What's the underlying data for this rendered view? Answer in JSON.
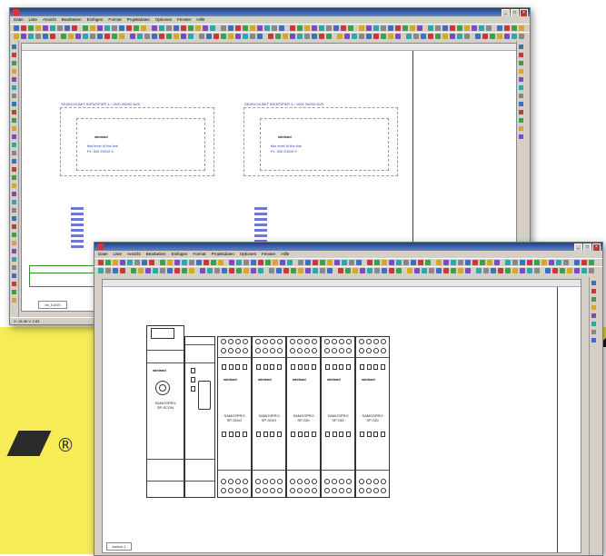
{
  "back_window": {
    "title": "",
    "menu": [
      "Datei",
      "Liste",
      "Ansicht",
      "Bearbeiten",
      "Einfügen",
      "Format",
      "Projektdaten",
      "Optionen",
      "Fenster",
      "Hilfe"
    ],
    "status": "X: 19,38   Y: 2,83",
    "sheet_tab": "bb_KASS",
    "group_a": {
      "header": "SEARCHLIMIT IDENTIFIER 3 / 1000 00050 00/5",
      "brand": "wieland",
      "line1": "this level of the link",
      "line2": "P.L 300 20010 0"
    },
    "group_b": {
      "header": "SEARCHLIMIT IDENTIFIER 3 / 1000 00050 00/5",
      "brand": "wieland",
      "line1": "this level of the link",
      "line2": "P.L 300 20010 0"
    }
  },
  "front_window": {
    "title": "",
    "menu": [
      "Datei",
      "Liste",
      "Ansicht",
      "Bearbeiten",
      "Einfügen",
      "Format",
      "Projektdaten",
      "Optionen",
      "Fenster",
      "Hilfe"
    ],
    "sheet_tab": "samos 1",
    "modules": [
      {
        "line1": "SAMOSPRO",
        "line2": "SP-SCON"
      },
      {
        "line1": "SAMOSPRO",
        "line2": "SP-SDIO"
      },
      {
        "line1": "SAMOSPRO",
        "line2": "SP-SDIO"
      },
      {
        "line1": "SAMOSPRO",
        "line2": "SP-SDI"
      },
      {
        "line1": "SAMOSPRO",
        "line2": "SP-SDI"
      },
      {
        "line1": "SAMOSPRO",
        "line2": "SP-SDI"
      }
    ],
    "brand": "wieland"
  },
  "promo": {
    "registered": "®"
  },
  "colors": {
    "titlebar": "#1c3f8f",
    "promo": "#f6ec55",
    "stripe": "#1a1a1a"
  }
}
